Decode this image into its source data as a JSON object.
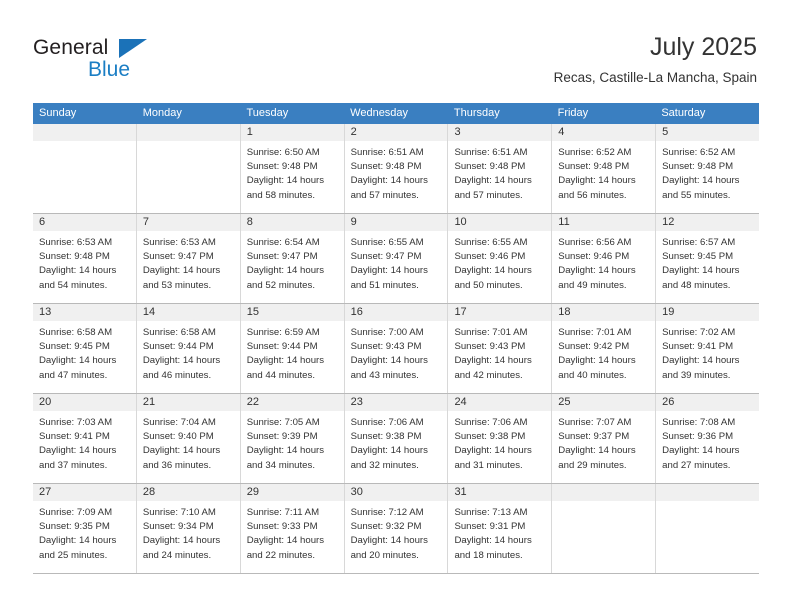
{
  "brand": {
    "name_top": "General",
    "name_bottom": "Blue",
    "triangle_color": "#1b72b8",
    "blue_color": "#1b7ec4"
  },
  "header": {
    "title": "July 2025",
    "subtitle": "Recas, Castille-La Mancha, Spain"
  },
  "theme": {
    "header_row_bg": "#3a7fc1",
    "header_row_text": "#ffffff",
    "daynum_band_bg": "#f0f0f0",
    "cell_border": "#d8d8d8",
    "week_border": "#b9b9b9",
    "text": "#333333"
  },
  "weekdays": [
    "Sunday",
    "Monday",
    "Tuesday",
    "Wednesday",
    "Thursday",
    "Friday",
    "Saturday"
  ],
  "weeks": [
    [
      {
        "day": "",
        "lines": []
      },
      {
        "day": "",
        "lines": []
      },
      {
        "day": "1",
        "lines": [
          "Sunrise: 6:50 AM",
          "Sunset: 9:48 PM",
          "Daylight: 14 hours",
          "and 58 minutes."
        ]
      },
      {
        "day": "2",
        "lines": [
          "Sunrise: 6:51 AM",
          "Sunset: 9:48 PM",
          "Daylight: 14 hours",
          "and 57 minutes."
        ]
      },
      {
        "day": "3",
        "lines": [
          "Sunrise: 6:51 AM",
          "Sunset: 9:48 PM",
          "Daylight: 14 hours",
          "and 57 minutes."
        ]
      },
      {
        "day": "4",
        "lines": [
          "Sunrise: 6:52 AM",
          "Sunset: 9:48 PM",
          "Daylight: 14 hours",
          "and 56 minutes."
        ]
      },
      {
        "day": "5",
        "lines": [
          "Sunrise: 6:52 AM",
          "Sunset: 9:48 PM",
          "Daylight: 14 hours",
          "and 55 minutes."
        ]
      }
    ],
    [
      {
        "day": "6",
        "lines": [
          "Sunrise: 6:53 AM",
          "Sunset: 9:48 PM",
          "Daylight: 14 hours",
          "and 54 minutes."
        ]
      },
      {
        "day": "7",
        "lines": [
          "Sunrise: 6:53 AM",
          "Sunset: 9:47 PM",
          "Daylight: 14 hours",
          "and 53 minutes."
        ]
      },
      {
        "day": "8",
        "lines": [
          "Sunrise: 6:54 AM",
          "Sunset: 9:47 PM",
          "Daylight: 14 hours",
          "and 52 minutes."
        ]
      },
      {
        "day": "9",
        "lines": [
          "Sunrise: 6:55 AM",
          "Sunset: 9:47 PM",
          "Daylight: 14 hours",
          "and 51 minutes."
        ]
      },
      {
        "day": "10",
        "lines": [
          "Sunrise: 6:55 AM",
          "Sunset: 9:46 PM",
          "Daylight: 14 hours",
          "and 50 minutes."
        ]
      },
      {
        "day": "11",
        "lines": [
          "Sunrise: 6:56 AM",
          "Sunset: 9:46 PM",
          "Daylight: 14 hours",
          "and 49 minutes."
        ]
      },
      {
        "day": "12",
        "lines": [
          "Sunrise: 6:57 AM",
          "Sunset: 9:45 PM",
          "Daylight: 14 hours",
          "and 48 minutes."
        ]
      }
    ],
    [
      {
        "day": "13",
        "lines": [
          "Sunrise: 6:58 AM",
          "Sunset: 9:45 PM",
          "Daylight: 14 hours",
          "and 47 minutes."
        ]
      },
      {
        "day": "14",
        "lines": [
          "Sunrise: 6:58 AM",
          "Sunset: 9:44 PM",
          "Daylight: 14 hours",
          "and 46 minutes."
        ]
      },
      {
        "day": "15",
        "lines": [
          "Sunrise: 6:59 AM",
          "Sunset: 9:44 PM",
          "Daylight: 14 hours",
          "and 44 minutes."
        ]
      },
      {
        "day": "16",
        "lines": [
          "Sunrise: 7:00 AM",
          "Sunset: 9:43 PM",
          "Daylight: 14 hours",
          "and 43 minutes."
        ]
      },
      {
        "day": "17",
        "lines": [
          "Sunrise: 7:01 AM",
          "Sunset: 9:43 PM",
          "Daylight: 14 hours",
          "and 42 minutes."
        ]
      },
      {
        "day": "18",
        "lines": [
          "Sunrise: 7:01 AM",
          "Sunset: 9:42 PM",
          "Daylight: 14 hours",
          "and 40 minutes."
        ]
      },
      {
        "day": "19",
        "lines": [
          "Sunrise: 7:02 AM",
          "Sunset: 9:41 PM",
          "Daylight: 14 hours",
          "and 39 minutes."
        ]
      }
    ],
    [
      {
        "day": "20",
        "lines": [
          "Sunrise: 7:03 AM",
          "Sunset: 9:41 PM",
          "Daylight: 14 hours",
          "and 37 minutes."
        ]
      },
      {
        "day": "21",
        "lines": [
          "Sunrise: 7:04 AM",
          "Sunset: 9:40 PM",
          "Daylight: 14 hours",
          "and 36 minutes."
        ]
      },
      {
        "day": "22",
        "lines": [
          "Sunrise: 7:05 AM",
          "Sunset: 9:39 PM",
          "Daylight: 14 hours",
          "and 34 minutes."
        ]
      },
      {
        "day": "23",
        "lines": [
          "Sunrise: 7:06 AM",
          "Sunset: 9:38 PM",
          "Daylight: 14 hours",
          "and 32 minutes."
        ]
      },
      {
        "day": "24",
        "lines": [
          "Sunrise: 7:06 AM",
          "Sunset: 9:38 PM",
          "Daylight: 14 hours",
          "and 31 minutes."
        ]
      },
      {
        "day": "25",
        "lines": [
          "Sunrise: 7:07 AM",
          "Sunset: 9:37 PM",
          "Daylight: 14 hours",
          "and 29 minutes."
        ]
      },
      {
        "day": "26",
        "lines": [
          "Sunrise: 7:08 AM",
          "Sunset: 9:36 PM",
          "Daylight: 14 hours",
          "and 27 minutes."
        ]
      }
    ],
    [
      {
        "day": "27",
        "lines": [
          "Sunrise: 7:09 AM",
          "Sunset: 9:35 PM",
          "Daylight: 14 hours",
          "and 25 minutes."
        ]
      },
      {
        "day": "28",
        "lines": [
          "Sunrise: 7:10 AM",
          "Sunset: 9:34 PM",
          "Daylight: 14 hours",
          "and 24 minutes."
        ]
      },
      {
        "day": "29",
        "lines": [
          "Sunrise: 7:11 AM",
          "Sunset: 9:33 PM",
          "Daylight: 14 hours",
          "and 22 minutes."
        ]
      },
      {
        "day": "30",
        "lines": [
          "Sunrise: 7:12 AM",
          "Sunset: 9:32 PM",
          "Daylight: 14 hours",
          "and 20 minutes."
        ]
      },
      {
        "day": "31",
        "lines": [
          "Sunrise: 7:13 AM",
          "Sunset: 9:31 PM",
          "Daylight: 14 hours",
          "and 18 minutes."
        ]
      },
      {
        "day": "",
        "lines": []
      },
      {
        "day": "",
        "lines": []
      }
    ]
  ]
}
